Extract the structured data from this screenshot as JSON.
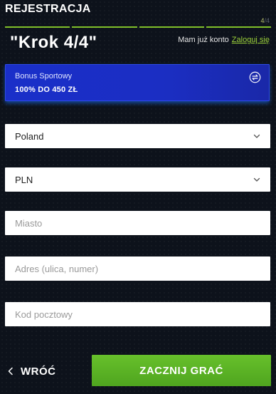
{
  "header": {
    "title": "REJESTRACJA",
    "step_current": "4",
    "step_sep_total": "/4"
  },
  "step": {
    "heading": "\"Krok 4/4\"",
    "account_text": "Mam już konto",
    "login_link": "Zaloguj się"
  },
  "bonus": {
    "name": "Bonus Sportowy",
    "amount": "100% DO 450 ZŁ",
    "icon": "swap-icon"
  },
  "form": {
    "country": {
      "value": "Poland"
    },
    "currency": {
      "value": "PLN"
    },
    "city": {
      "placeholder": "Miasto"
    },
    "address": {
      "placeholder": "Adres (ulica, numer)"
    },
    "postal_code": {
      "placeholder": "Kod pocztowy"
    }
  },
  "footer": {
    "back_label": "WRÓĆ",
    "start_label": "ZACZNIJ GRAĆ"
  },
  "colors": {
    "background": "#0d121b",
    "accent_green": "#5cb425",
    "bonus_blue": "#1a2fc9",
    "link": "#9cd13a"
  }
}
